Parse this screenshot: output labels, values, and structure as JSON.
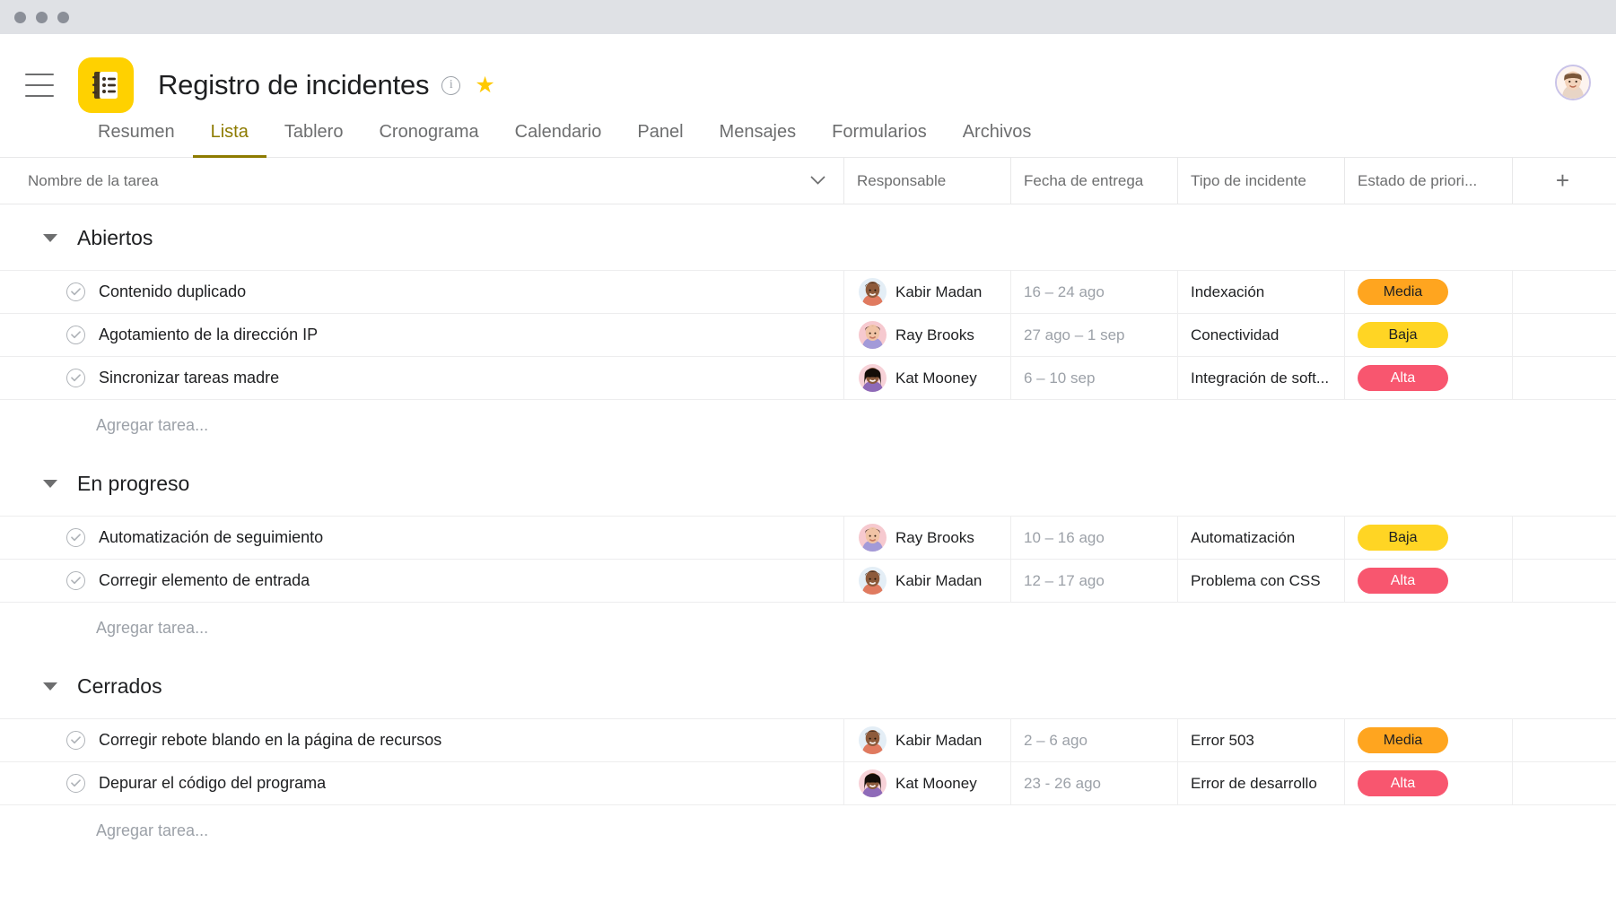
{
  "window": {
    "traffic_lights": [
      "close",
      "minimize",
      "maximize"
    ]
  },
  "header": {
    "menu_icon": "hamburger-icon",
    "logo_icon": "project-list-logo",
    "title": "Registro de incidentes",
    "info_icon": "info-icon",
    "star_icon": "star-icon",
    "avatar": "user-avatar"
  },
  "tabs": [
    {
      "label": "Resumen",
      "active": false
    },
    {
      "label": "Lista",
      "active": true
    },
    {
      "label": "Tablero",
      "active": false
    },
    {
      "label": "Cronograma",
      "active": false
    },
    {
      "label": "Calendario",
      "active": false
    },
    {
      "label": "Panel",
      "active": false
    },
    {
      "label": "Mensajes",
      "active": false
    },
    {
      "label": "Formularios",
      "active": false
    },
    {
      "label": "Archivos",
      "active": false
    }
  ],
  "columns": {
    "name": "Nombre de la tarea",
    "owner": "Responsable",
    "date": "Fecha de entrega",
    "type": "Tipo de incidente",
    "priority": "Estado de priori...",
    "add": "+"
  },
  "add_task_label": "Agregar tarea...",
  "colors": {
    "accent": "#ffd100",
    "tab_active": "#8d7b00",
    "priority_media": "#ffa51f",
    "priority_baja": "#ffd524",
    "priority_alta": "#f8566f"
  },
  "sections": [
    {
      "title": "Abiertos",
      "tasks": [
        {
          "name": "Contenido duplicado",
          "owner": "Kabir Madan",
          "date": "16 – 24 ago",
          "type": "Indexación",
          "priority": "Media",
          "priority_key": "media"
        },
        {
          "name": "Agotamiento de la dirección IP",
          "owner": "Ray Brooks",
          "date": "27 ago – 1 sep",
          "type": "Conectividad",
          "priority": "Baja",
          "priority_key": "baja"
        },
        {
          "name": "Sincronizar tareas madre",
          "owner": "Kat Mooney",
          "date": "6 – 10 sep",
          "type": "Integración de soft...",
          "priority": "Alta",
          "priority_key": "alta"
        }
      ]
    },
    {
      "title": "En progreso",
      "tasks": [
        {
          "name": "Automatización de seguimiento",
          "owner": "Ray Brooks",
          "date": "10 – 16 ago",
          "type": "Automatización",
          "priority": "Baja",
          "priority_key": "baja"
        },
        {
          "name": "Corregir elemento de entrada",
          "owner": "Kabir Madan",
          "date": "12 – 17 ago",
          "type": "Problema con CSS",
          "priority": "Alta",
          "priority_key": "alta"
        }
      ]
    },
    {
      "title": "Cerrados",
      "tasks": [
        {
          "name": "Corregir rebote blando en la página de recursos",
          "owner": "Kabir Madan",
          "date": "2 – 6 ago",
          "type": "Error 503",
          "priority": "Media",
          "priority_key": "media"
        },
        {
          "name": "Depurar el código del programa",
          "owner": "Kat Mooney",
          "date": "23 - 26 ago",
          "type": "Error de desarrollo",
          "priority": "Alta",
          "priority_key": "alta"
        }
      ]
    }
  ]
}
